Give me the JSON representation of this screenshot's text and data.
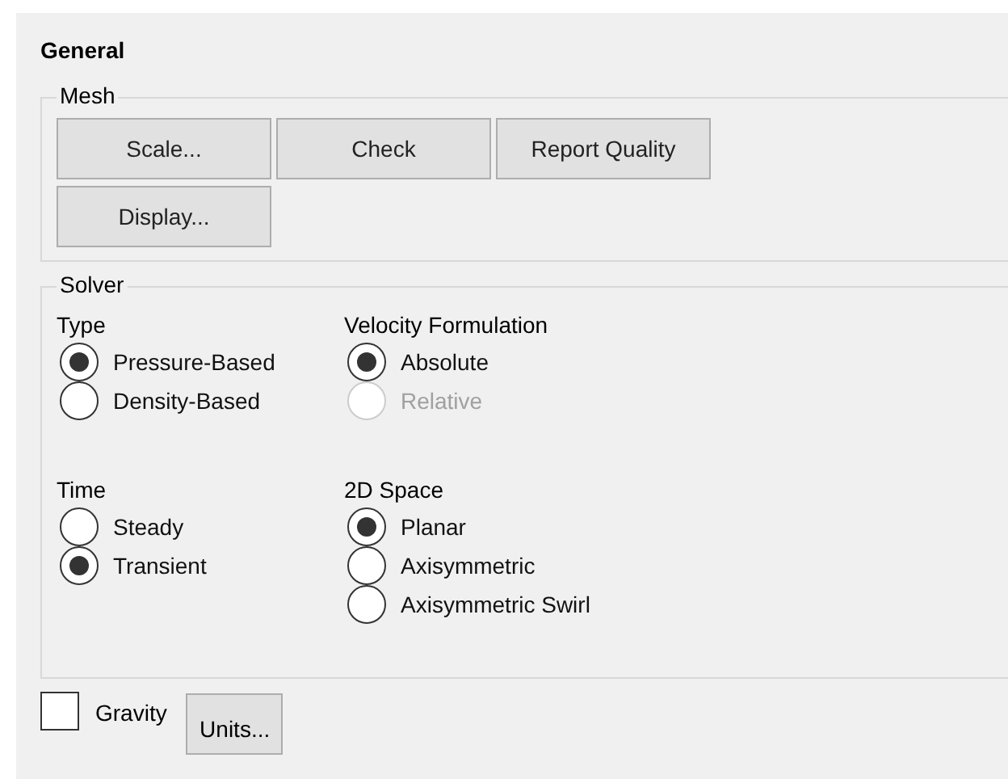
{
  "title": "General",
  "mesh": {
    "label": "Mesh",
    "buttons": [
      "Scale...",
      "Check",
      "Report Quality",
      "Display..."
    ]
  },
  "solver": {
    "label": "Solver",
    "groups": [
      {
        "label": "Type",
        "options": [
          {
            "label": "Pressure-Based",
            "selected": true,
            "disabled": false
          },
          {
            "label": "Density-Based",
            "selected": false,
            "disabled": false
          }
        ]
      },
      {
        "label": "Velocity Formulation",
        "options": [
          {
            "label": "Absolute",
            "selected": true,
            "disabled": false
          },
          {
            "label": "Relative",
            "selected": false,
            "disabled": true
          }
        ]
      },
      {
        "label": "Time",
        "options": [
          {
            "label": "Steady",
            "selected": false,
            "disabled": false
          },
          {
            "label": "Transient",
            "selected": true,
            "disabled": false
          }
        ]
      },
      {
        "label": "2D Space",
        "options": [
          {
            "label": "Planar",
            "selected": true,
            "disabled": false
          },
          {
            "label": "Axisymmetric",
            "selected": false,
            "disabled": false
          },
          {
            "label": "Axisymmetric Swirl",
            "selected": false,
            "disabled": false
          }
        ]
      }
    ]
  },
  "gravity": {
    "label": "Gravity",
    "checked": false
  },
  "units_button": "Units..."
}
